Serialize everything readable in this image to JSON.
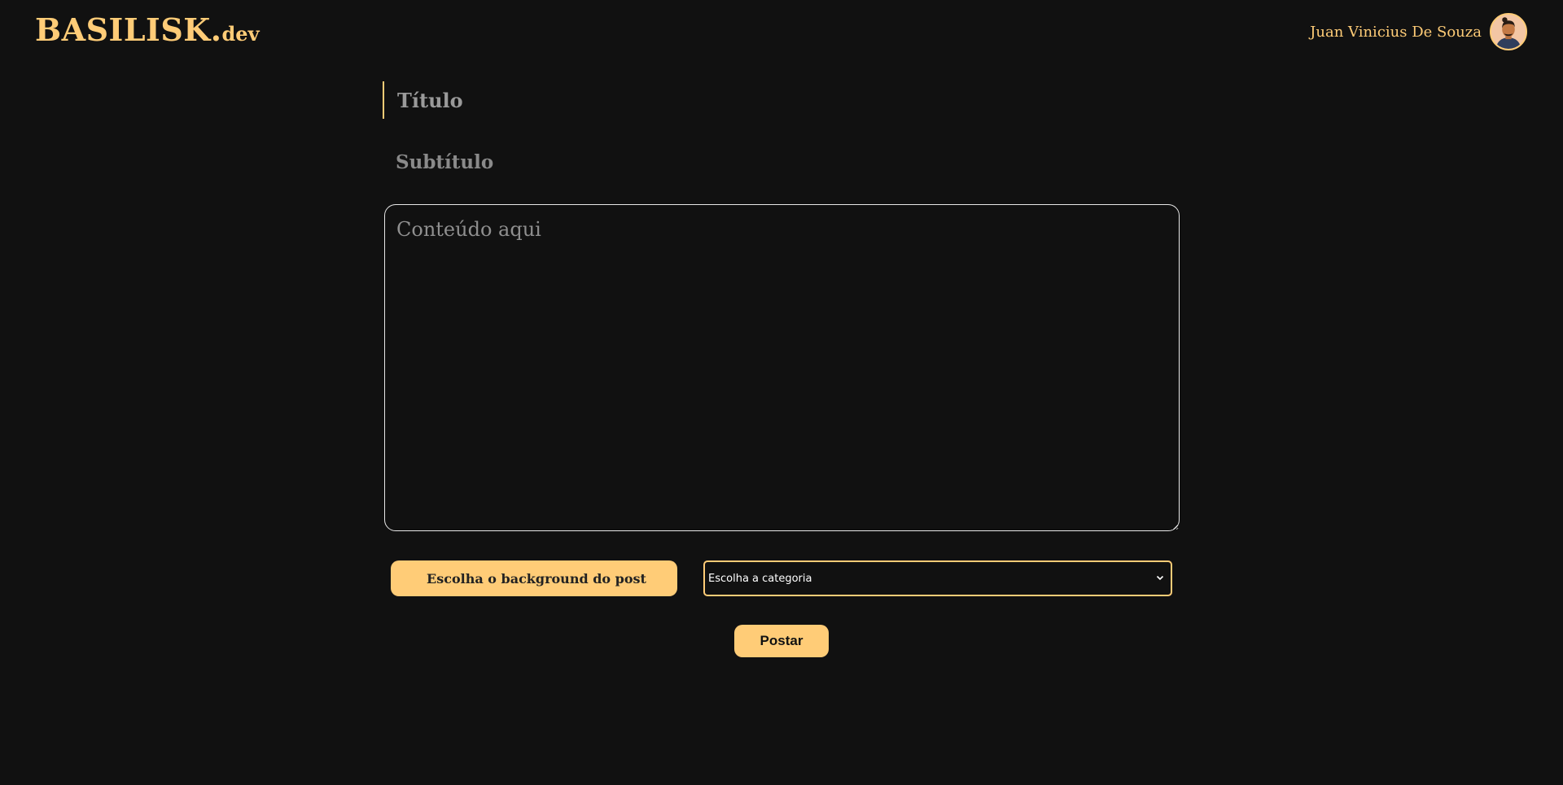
{
  "header": {
    "logo_main": "BASILISK.",
    "logo_tld": "dev",
    "user_name": "Juan Vinicius De Souza",
    "avatar_icon": "user-avatar-icon"
  },
  "form": {
    "title_placeholder": "Título",
    "subtitle_placeholder": "Subtítulo",
    "content_placeholder": "Conteúdo aqui",
    "background_button_label": "Escolha o background do post",
    "category_selected": "Escolha a categoria",
    "post_button_label": "Postar"
  },
  "colors": {
    "background": "#111111",
    "accent": "#ffcc77"
  }
}
